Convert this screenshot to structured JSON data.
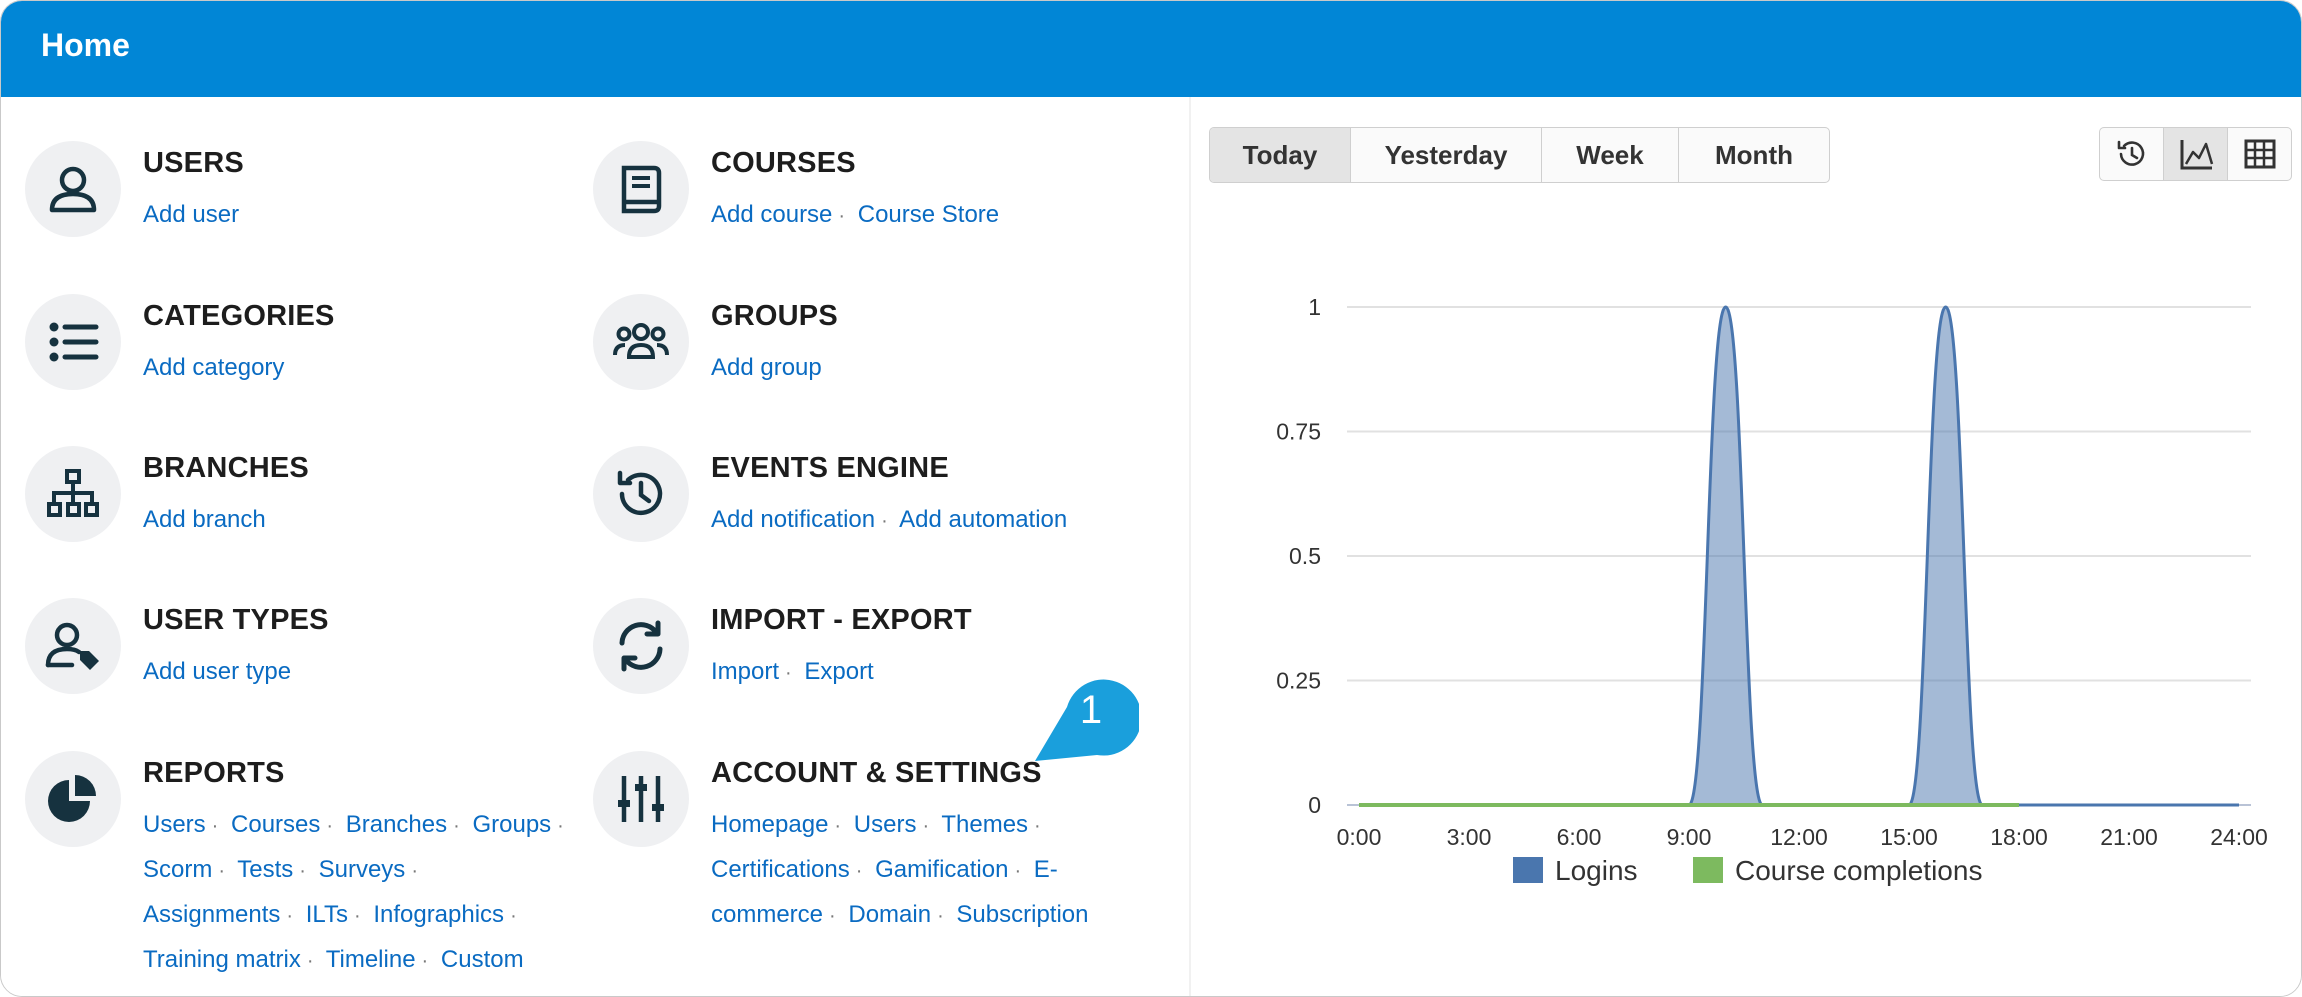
{
  "header": {
    "title": "Home"
  },
  "sections": [
    {
      "heading": "USERS",
      "icon": "user-icon",
      "links": [
        "Add user"
      ]
    },
    {
      "heading": "COURSES",
      "icon": "book-icon",
      "links": [
        "Add course",
        "Course Store"
      ]
    },
    {
      "heading": "CATEGORIES",
      "icon": "list-icon",
      "links": [
        "Add category"
      ]
    },
    {
      "heading": "GROUPS",
      "icon": "group-icon",
      "links": [
        "Add group"
      ]
    },
    {
      "heading": "BRANCHES",
      "icon": "sitemap-icon",
      "links": [
        "Add branch"
      ]
    },
    {
      "heading": "EVENTS ENGINE",
      "icon": "history-icon",
      "links": [
        "Add notification",
        "Add automation"
      ]
    },
    {
      "heading": "USER TYPES",
      "icon": "user-tag-icon",
      "links": [
        "Add user type"
      ]
    },
    {
      "heading": "IMPORT - EXPORT",
      "icon": "sync-icon",
      "links": [
        "Import",
        "Export"
      ]
    },
    {
      "heading": "REPORTS",
      "icon": "pie-chart-icon",
      "links": [
        "Users",
        "Courses",
        "Branches",
        "Groups",
        "Scorm",
        "Tests",
        "Surveys",
        "Assignments",
        "ILTs",
        "Infographics",
        "Training matrix",
        "Timeline",
        "Custom"
      ]
    },
    {
      "heading": "ACCOUNT & SETTINGS",
      "icon": "sliders-icon",
      "links": [
        "Homepage",
        "Users",
        "Themes",
        "Certifications",
        "Gamification",
        "E-commerce",
        "Domain",
        "Subscription"
      ]
    }
  ],
  "callout": {
    "label": "1",
    "color": "#1a9fdc"
  },
  "period_tabs": [
    "Today",
    "Yesterday",
    "Week",
    "Month"
  ],
  "period_active": "Today",
  "view_buttons": [
    "history-icon",
    "area-chart-icon",
    "table-icon"
  ],
  "view_active": "area-chart-icon",
  "chart_data": {
    "type": "area",
    "x_ticks": [
      "0:00",
      "3:00",
      "6:00",
      "9:00",
      "12:00",
      "15:00",
      "18:00",
      "21:00",
      "24:00"
    ],
    "y_ticks": [
      "0",
      "0.25",
      "0.5",
      "0.75",
      "1"
    ],
    "ylim": [
      0,
      1
    ],
    "xlim": [
      0,
      24
    ],
    "grid": true,
    "legend_position": "bottom",
    "series": [
      {
        "name": "Logins",
        "color": "#4a76ae",
        "points": [
          [
            0.0,
            0
          ],
          [
            9.0,
            0
          ],
          [
            10.0,
            1
          ],
          [
            11.0,
            0
          ],
          [
            15.0,
            0
          ],
          [
            16.0,
            1
          ],
          [
            17.0,
            0
          ],
          [
            24.0,
            0
          ]
        ]
      },
      {
        "name": "Course completions",
        "color": "#7dba5f",
        "points": [
          [
            0.0,
            0
          ],
          [
            18.0,
            0
          ]
        ]
      }
    ]
  }
}
